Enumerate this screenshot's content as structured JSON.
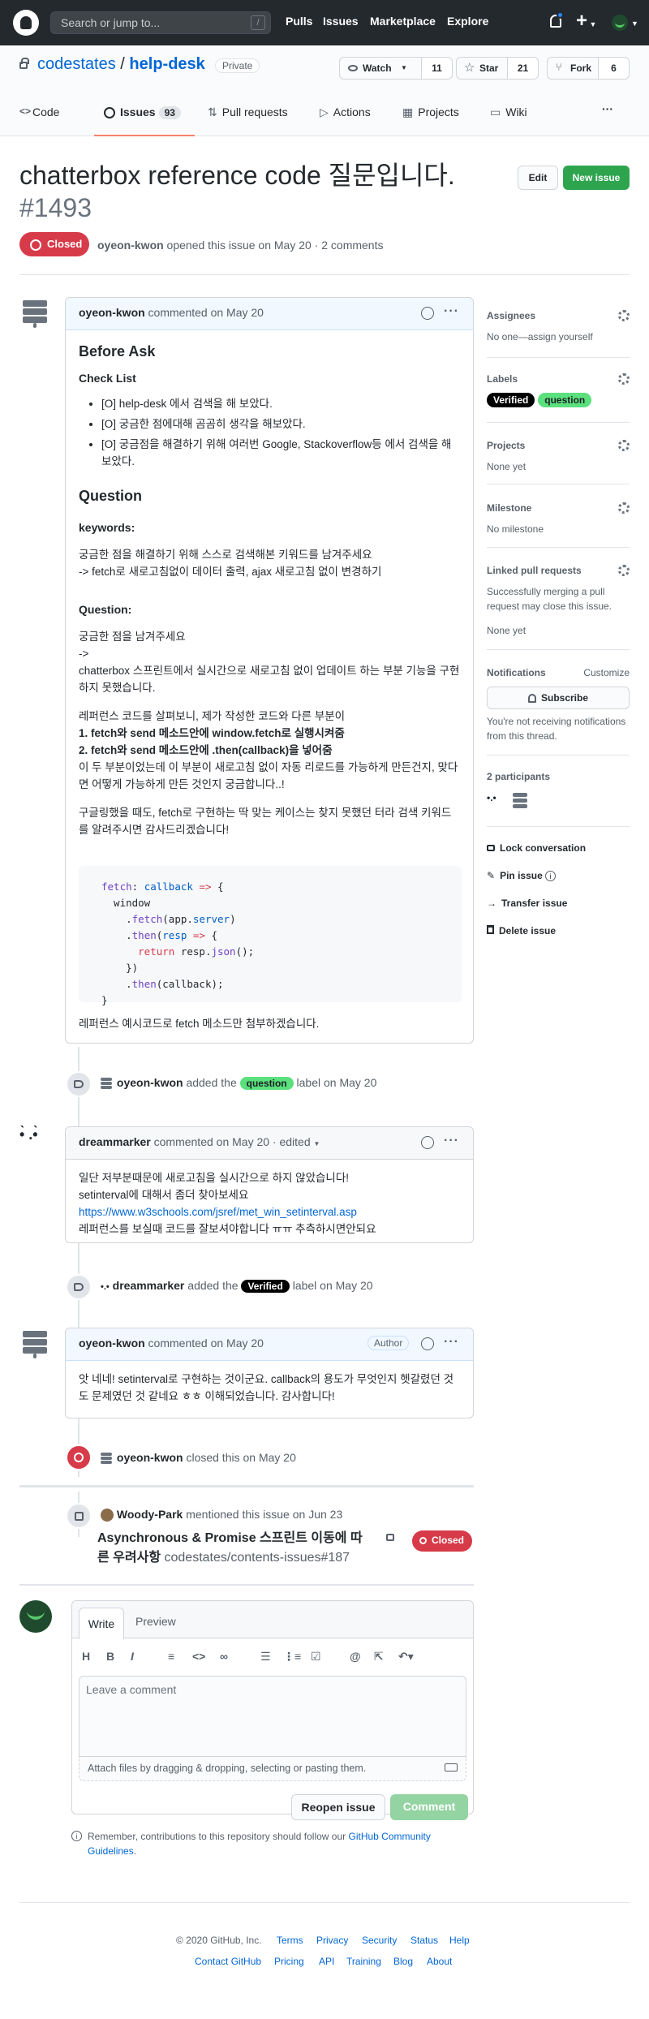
{
  "header": {
    "search_placeholder": "Search or jump to...",
    "slash": "/",
    "nav": [
      "Pulls",
      "Issues",
      "Marketplace",
      "Explore"
    ]
  },
  "repo": {
    "owner": "codestates",
    "sep": "/",
    "name": "help-desk",
    "visibility": "Private",
    "watch_label": "Watch",
    "watch_count": "11",
    "star_label": "Star",
    "star_count": "21",
    "fork_label": "Fork",
    "fork_count": "6"
  },
  "tabs": {
    "code": "Code",
    "issues": "Issues",
    "issues_count": "93",
    "pulls": "Pull requests",
    "actions": "Actions",
    "projects": "Projects",
    "wiki": "Wiki",
    "more": "···"
  },
  "issue": {
    "title": "chatterbox reference code 질문입니다.",
    "number": "#1493",
    "edit": "Edit",
    "new_issue": "New issue",
    "state": "Closed",
    "author": "oyeon-kwon",
    "meta": " opened this issue on May 20 · 2 comments"
  },
  "comment1": {
    "author": "oyeon-kwon",
    "meta": " commented on May 20",
    "before_ask": "Before Ask",
    "checklist": "Check List",
    "items": [
      "[O] help-desk 에서 검색을 해 보았다.",
      "[O] 궁금한 점에대해 곰곰히 생각을 해보았다.",
      "[O] 궁금점을 해결하기 위해 여러번 Google, Stackoverflow등 에서 검색을 해보았다."
    ],
    "question": "Question",
    "keywords": "keywords:",
    "kw1": "궁금한 점을 해결하기 위해 스스로 검색해본 키워드를 남겨주세요",
    "kw2": "-> fetch로 새로고침없이 데이터 출력, ajax 새로고침 없이 변경하기",
    "question2": "Question:",
    "q1": "궁금한 점을 남겨주세요",
    "q2": "->",
    "q3": "chatterbox 스프린트에서 실시간으로 새로고침 없이 업데이트 하는 부분 기능을 구현하지 못했습니다.",
    "r1": "레퍼런스 코드를 살펴보니, 제가 작성한 코드와 다른 부분이",
    "r2": "1. fetch와 send 메소드안에 window.fetch로 실행시켜줌",
    "r3": "2. fetch와 send 메소드안에 .then(callback)을 넣어줌",
    "r4": "이 두 부분이었는데 이 부분이 새로고침 없이 자동 리로드를 가능하게 만든건지, 맞다면 어떻게 가능하게 만든 것인지 궁금합니다..!",
    "g1": "구글링했을 때도, fetch로 구현하는 딱 맞는 케이스는 찾지 못했던 터라 검색 키워드를 알려주시면 감사드리겠습니다!",
    "code": [
      "fetch: callback => {",
      "  window",
      "    .fetch(app.server)",
      "    .then(resp => {",
      "      return resp.json();",
      "    })",
      "    .then(callback);",
      "}"
    ],
    "footer": "레퍼런스 예시코드로 fetch 메소드만 첨부하겠습니다."
  },
  "sidebar": {
    "assignees": "Assignees",
    "assignees_val": "No one—assign yourself",
    "labels": "Labels",
    "label1": "Verified",
    "label2": "question",
    "projects": "Projects",
    "projects_val": "None yet",
    "milestone": "Milestone",
    "milestone_val": "No milestone",
    "linked": "Linked pull requests",
    "linked_desc": "Successfully merging a pull request may close this issue.",
    "linked_val": "None yet",
    "notifications": "Notifications",
    "customize": "Customize",
    "subscribe": "Subscribe",
    "notif_desc": "You're not receiving notifications from this thread.",
    "participants": "2 participants",
    "lock": "Lock conversation",
    "pin": "Pin issue",
    "transfer": "Transfer issue",
    "delete": "Delete issue"
  },
  "event1": {
    "author": "oyeon-kwon",
    "text": " added the ",
    "label": "question",
    "suffix": " label on May 20"
  },
  "comment2": {
    "author": "dreammarker",
    "meta": " commented on May 20 · edited ",
    "l1": "일단 저부분때문에 새로고침을 실시간으로 하지 않았습니다!",
    "l2": "setinterval에 대해서 좀더 찾아보세요",
    "l3": "https://www.w3schools.com/jsref/met_win_setinterval.asp",
    "l4": "레퍼런스를 보실때 코드를 잘보셔야합니다 ㅠㅠ 추측하시면안되요"
  },
  "event2": {
    "author": "dreammarker",
    "text": " added the ",
    "label": "Verified",
    "suffix": " label on May 20"
  },
  "comment3": {
    "author": "oyeon-kwon",
    "meta": " commented on May 20",
    "badge": "Author",
    "l1": "앗 네네! setinterval로 구현하는 것이군요. callback의 용도가 무엇인지 헷갈렸던 것도 문제였던 것 같네요 ㅎㅎ 이해되었습니다. 감사합니다!"
  },
  "event3": {
    "author": "oyeon-kwon",
    "text": " closed this on May 20"
  },
  "mention": {
    "author": "Woody-Park",
    "text": " mentioned this issue on Jun 23",
    "title": "Asynchronous & Promise 스프린트 이동에 따른 우려사항",
    "ref": " codestates/contents-issues#187",
    "state": "Closed"
  },
  "editor": {
    "write": "Write",
    "preview": "Preview",
    "placeholder": "Leave a comment",
    "attach": "Attach files by dragging & dropping, selecting or pasting them.",
    "reopen": "Reopen issue",
    "comment": "Comment",
    "remember": "Remember, contributions to this repository should follow our ",
    "guidelines": "GitHub Community Guidelines",
    "period": "."
  },
  "footer": {
    "copy": "© 2020 GitHub, Inc.",
    "row1": [
      "Terms",
      "Privacy",
      "Security",
      "Status",
      "Help"
    ],
    "row2": [
      "Contact GitHub",
      "Pricing",
      "API",
      "Training",
      "Blog",
      "About"
    ]
  },
  "colors": {
    "green": "#2ea44f",
    "red": "#d73a49",
    "blue": "#0366d6",
    "verified_bg": "#000000",
    "question_bg": "#5ae07d"
  }
}
